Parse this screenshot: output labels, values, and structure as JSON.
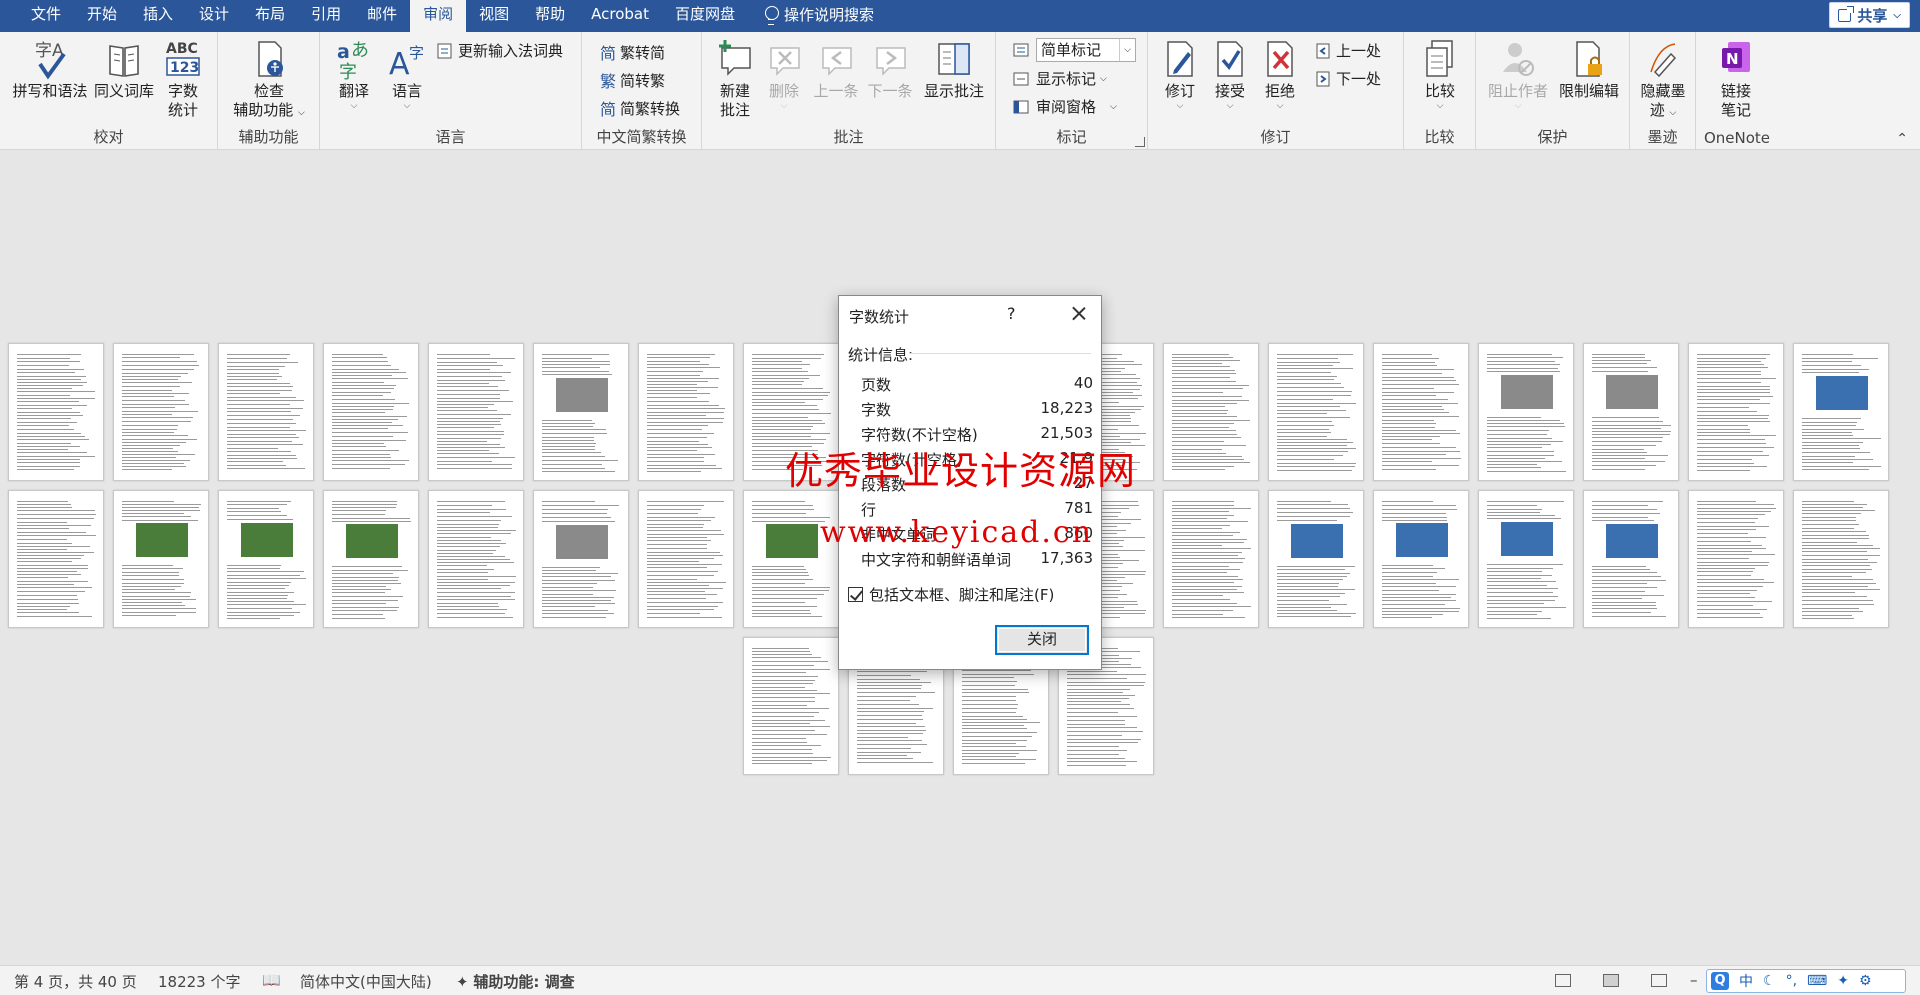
{
  "tabs": [
    "文件",
    "开始",
    "插入",
    "设计",
    "布局",
    "引用",
    "邮件",
    "审阅",
    "视图",
    "帮助",
    "Acrobat",
    "百度网盘"
  ],
  "active_tab": "审阅",
  "tell_me": "操作说明搜索",
  "share": "共享",
  "ribbon": {
    "proofing": {
      "label": "校对",
      "spelling": "拼写和语法",
      "thesaurus": "同义词库",
      "wordcount_icon": "ABC\n123",
      "wordcount_1": "字数",
      "wordcount_2": "统计"
    },
    "accessibility": {
      "label": "辅助功能",
      "check_1": "检查",
      "check_2": "辅助功能"
    },
    "language": {
      "label": "语言",
      "translate": "翻译",
      "language": "语言",
      "update_ime": "更新输入法词典"
    },
    "chinese": {
      "label": "中文简繁转换",
      "to_simplified": "繁转简",
      "to_traditional": "简转繁",
      "convert": "简繁转换"
    },
    "comments": {
      "label": "批注",
      "new_1": "新建",
      "new_2": "批注",
      "delete": "删除",
      "prev": "上一条",
      "next": "下一条",
      "show": "显示批注"
    },
    "tracking": {
      "label": "标记",
      "markup_select": "简单标记",
      "show_markup": "显示标记",
      "reviewing_pane": "审阅窗格"
    },
    "changes": {
      "label": "修订",
      "track": "修订",
      "accept": "接受",
      "reject": "拒绝",
      "previous": "上一处",
      "next": "下一处"
    },
    "compare": {
      "label": "比较",
      "compare": "比较"
    },
    "protect": {
      "label": "保护",
      "block_authors": "阻止作者",
      "restrict": "限制编辑"
    },
    "ink": {
      "label": "墨迹",
      "hide_1": "隐藏墨",
      "hide_2": "迹"
    },
    "onenote": {
      "label": "OneNote",
      "link_1": "链接",
      "link_2": "笔记"
    }
  },
  "dialog": {
    "title": "字数统计",
    "help": "?",
    "stats_header": "统计信息:",
    "stats": [
      {
        "label": "页数",
        "value": "40"
      },
      {
        "label": "字数",
        "value": "18,223"
      },
      {
        "label": "字符数(不计空格)",
        "value": "21,503"
      },
      {
        "label": "字符数(计空格)",
        "value": "21,9"
      },
      {
        "label": "段落数",
        "value": "27"
      },
      {
        "label": "行",
        "value": "781"
      },
      {
        "label": "非中文单词",
        "value": "860"
      },
      {
        "label": "中文字符和朝鲜语单词",
        "value": "17,363"
      }
    ],
    "include_label": "包括文本框、脚注和尾注(F)",
    "include_checked": true,
    "close_button": "关闭"
  },
  "watermark": {
    "line1": "优秀毕业设计资源网",
    "line2": "www.keyicad.cn"
  },
  "status": {
    "page": "第 4 页，共 40 页",
    "words": "18223 个字",
    "language": "简体中文(中国大陆)",
    "accessibility": "辅助功能: 调查"
  },
  "ime": {
    "q": "Q",
    "mode": "中"
  }
}
